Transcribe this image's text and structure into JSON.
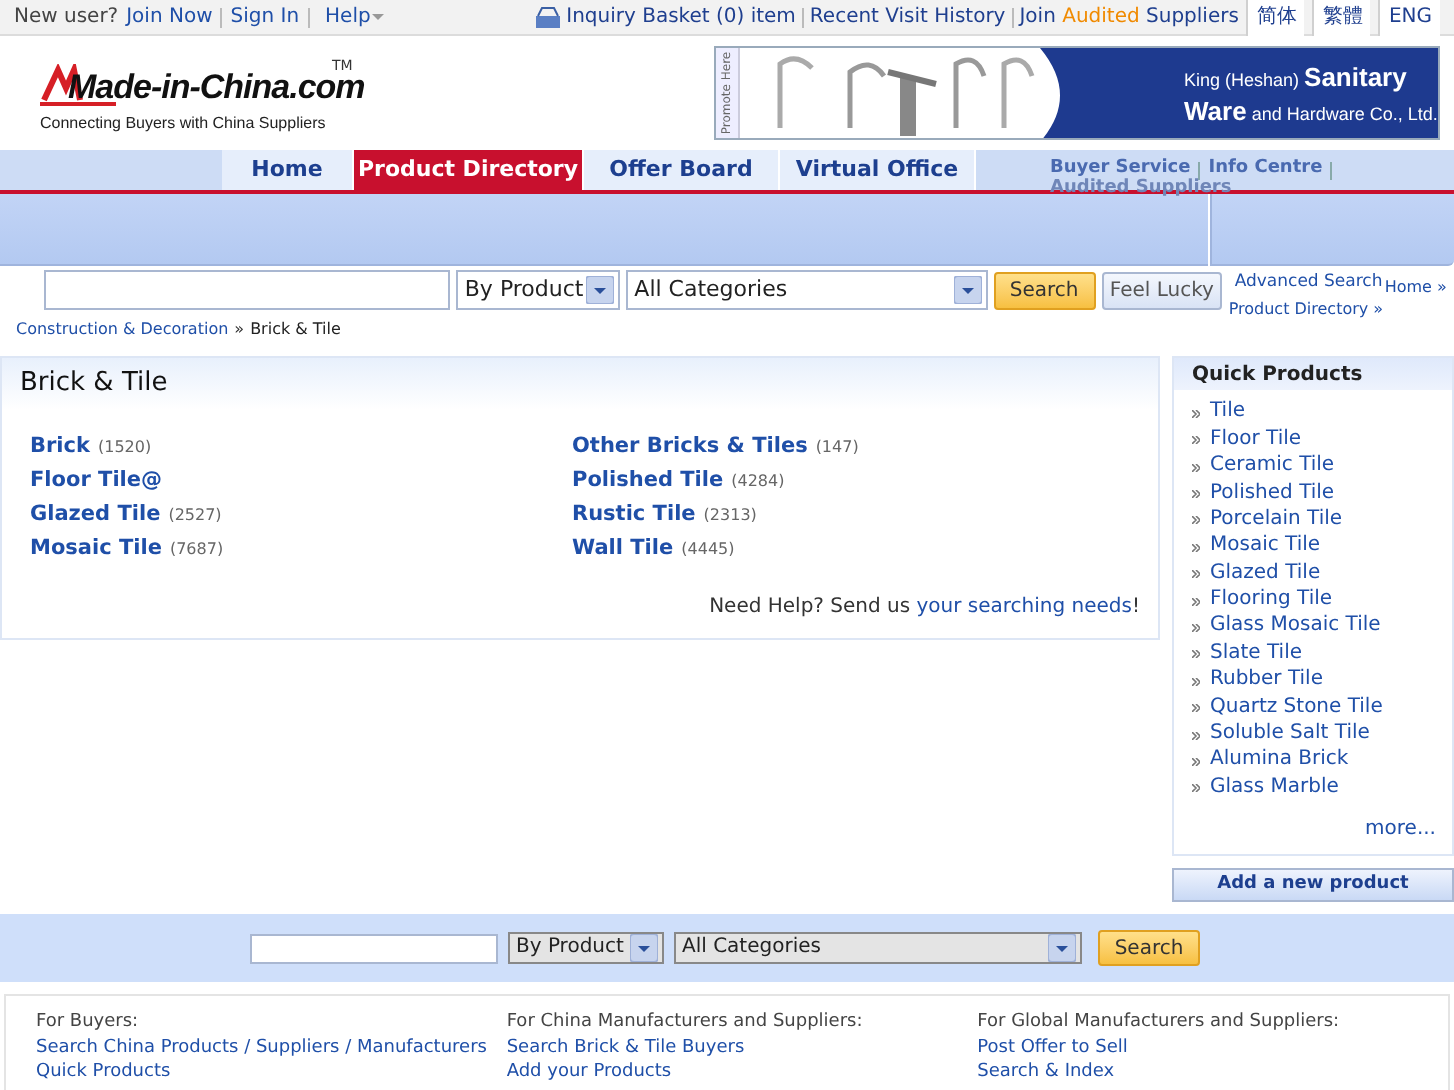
{
  "top_bar": {
    "new_user_label": "New user?",
    "links": [
      "Join Now",
      "Sign In"
    ],
    "help": "Help",
    "inquiry_basket": "Inquiry Basket (0) item",
    "recent_history": "Recent Visit History",
    "join_audited": {
      "before": "Join",
      "highlight": "Audited",
      "after": "Suppliers"
    },
    "languages": [
      "简体",
      "繁體",
      "ENG"
    ]
  },
  "logo": {
    "text": "Made-in-China.com",
    "trademark": "TM",
    "tagline": "Connecting Buyers with China Suppliers"
  },
  "banner": {
    "tab": "Promote Here",
    "lines": [
      "King (Heshan) **Sanitary**",
      "**Ware** and Hardware Co., Ltd."
    ]
  },
  "nav": {
    "tabs": [
      {
        "label": "Home",
        "selected": false
      },
      {
        "label": "Product Directory",
        "selected": true
      },
      {
        "label": "Offer Board",
        "selected": false
      },
      {
        "label": "Virtual Office",
        "selected": false
      }
    ],
    "secondary_links": [
      "Buyer Service",
      "Info Centre"
    ],
    "audited_suppliers": "Audited Suppliers"
  },
  "search": {
    "type_select": "By Product",
    "category_select": "All Categories",
    "search_button": "Search",
    "lucky_button": "Feel Lucky",
    "advanced_search": "Advanced Search",
    "crumbs": [
      "Home »",
      "Product Directory »"
    ]
  },
  "breadcrumb": {
    "items": [
      "Construction & Decoration",
      "Brick & Tile"
    ],
    "separator": "»"
  },
  "category": {
    "title": "Brick & Tile",
    "columns": [
      [
        {
          "name": "Brick",
          "count": "(1520)"
        },
        {
          "name": "Floor Tile@"
        },
        {
          "name": "Glazed Tile",
          "count": "(2527)"
        },
        {
          "name": "Mosaic Tile",
          "count": "(7687)"
        }
      ],
      [
        {
          "name": "Other Bricks & Tiles",
          "count": "(147)"
        },
        {
          "name": "Polished Tile",
          "count": "(4284)"
        },
        {
          "name": "Rustic Tile",
          "count": "(2313)"
        },
        {
          "name": "Wall Tile",
          "count": "(4445)"
        }
      ]
    ],
    "help": {
      "text": "Need Help? Send us",
      "link": "your searching needs",
      "end": "!"
    }
  },
  "quick_products": {
    "title": "Quick Products",
    "items": [
      "Tile",
      "Floor Tile",
      "Ceramic Tile",
      "Polished Tile",
      "Porcelain Tile",
      "Mosaic Tile",
      "Glazed Tile",
      "Flooring Tile",
      "Glass Mosaic Tile",
      "Slate Tile",
      "Rubber Tile",
      "Quartz Stone Tile",
      "Soluble Salt Tile",
      "Alumina Brick",
      "Glass Marble"
    ],
    "more": "more...",
    "add_button": "Add a new product"
  },
  "bottom_search": {
    "type_select": "By Product",
    "category_select": "All Categories",
    "search_button": "Search"
  },
  "footer": {
    "columns": [
      {
        "heading": "For Buyers:",
        "links": [
          "Search China Products / Suppliers / Manufacturers",
          "Quick Products"
        ]
      },
      {
        "heading": "For China Manufacturers and Suppliers:",
        "links": [
          "Search Brick & Tile Buyers",
          "Add your Products"
        ]
      },
      {
        "heading": "For Global Manufacturers and Suppliers:",
        "links": [
          "Post Offer to Sell",
          "Search & Index"
        ]
      }
    ]
  }
}
